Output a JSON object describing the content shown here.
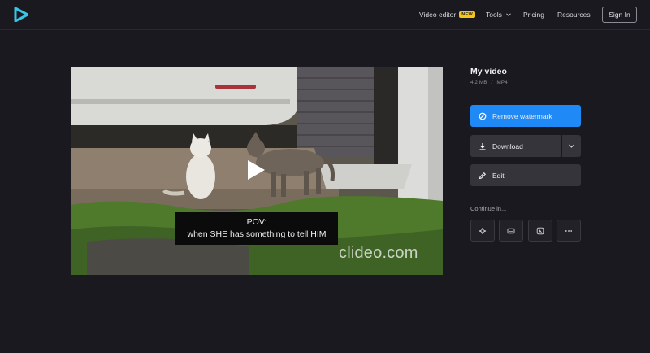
{
  "header": {
    "nav": {
      "video_editor": "Video editor",
      "new_badge": "NEW",
      "tools": "Tools",
      "pricing": "Pricing",
      "resources": "Resources"
    },
    "signin": "Sign In"
  },
  "video": {
    "caption_line1": "POV:",
    "caption_line2": "when SHE has something to tell HIM",
    "watermark": "clideo.com"
  },
  "panel": {
    "title": "My video",
    "size": "4.2 MB",
    "separator": "/",
    "format": "MP4",
    "remove_watermark": "Remove watermark",
    "download": "Download",
    "edit": "Edit",
    "continue_in": "Continue in..."
  },
  "icons": {
    "logo": "play-logo-icon",
    "continue": [
      "sparkle-icon",
      "subtitles-icon",
      "crop-icon",
      "more-icon"
    ]
  },
  "colors": {
    "background": "#1a191f",
    "accent": "#1f8af5",
    "badge": "#f5c518",
    "button_dark": "#35343b"
  }
}
